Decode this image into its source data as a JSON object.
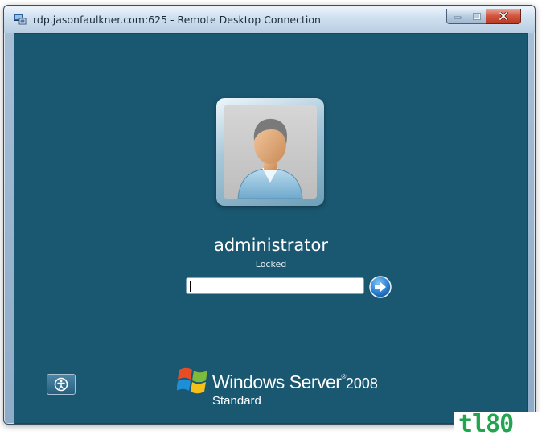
{
  "window": {
    "title": "rdp.jasonfaulkner.com:625 - Remote Desktop Connection",
    "icon": "remote-desktop-icon"
  },
  "controls": {
    "minimize_icon": "minimize-icon",
    "maximize_icon": "maximize-icon",
    "close_icon": "close-icon"
  },
  "login": {
    "username": "administrator",
    "status": "Locked",
    "password_value": "",
    "submit_icon": "arrow-right-icon",
    "ease_of_access_icon": "ease-of-access-icon"
  },
  "branding": {
    "product": "Windows Server",
    "registered": "®",
    "year": "2008",
    "edition": "Standard"
  },
  "watermark": {
    "text": "tl80"
  },
  "colors": {
    "background": "#1a5771",
    "close_button": "#c8452c",
    "watermark": "#22a54f"
  }
}
